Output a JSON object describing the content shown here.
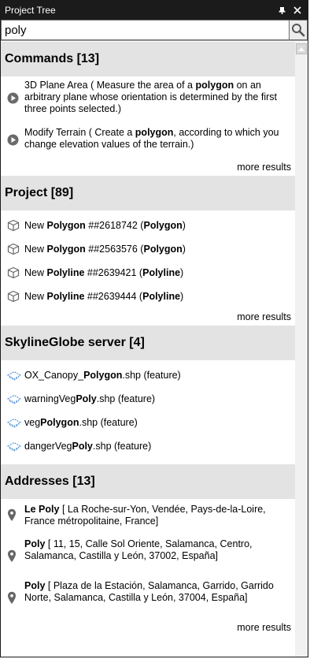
{
  "window": {
    "title": "Project Tree",
    "pin_glyph": "⊓",
    "close_glyph": "✕"
  },
  "search": {
    "value": "poly",
    "button_icon": "search-icon"
  },
  "sections": {
    "commands": {
      "header": "Commands [13]",
      "items": [
        {
          "pre": "3D Plane Area ( Measure the area of a ",
          "bold": "polygon",
          "post": " on an arbitrary plane whose orientation is determined by the first three points selected.)"
        },
        {
          "pre": "Modify Terrain ( Create a ",
          "bold": "polygon",
          "post": ", according to which you change elevation values of the terrain.)"
        }
      ],
      "more": "more results"
    },
    "project": {
      "header": "Project [89]",
      "items": [
        {
          "a": "New ",
          "b": "Polygon",
          "c": " ##2618742 (",
          "d": "Polygon",
          "e": ")"
        },
        {
          "a": "New ",
          "b": "Polygon",
          "c": " ##2563576 (",
          "d": "Polygon",
          "e": ")"
        },
        {
          "a": "New ",
          "b": "Polyline",
          "c": " ##2639421 (",
          "d": "Polyline",
          "e": ")"
        },
        {
          "a": "New ",
          "b": "Polyline",
          "c": " ##2639444 (",
          "d": "Polyline",
          "e": ")"
        }
      ],
      "more": "more results"
    },
    "server": {
      "header": "SkylineGlobe server [4]",
      "items": [
        {
          "a": "OX_Canopy_",
          "b": "Polygon",
          "c": ".shp (feature)"
        },
        {
          "a": "warningVeg",
          "b": "Poly",
          "c": ".shp (feature)"
        },
        {
          "a": "veg",
          "b": "Polygon",
          "c": ".shp (feature)"
        },
        {
          "a": "dangerVeg",
          "b": "Poly",
          "c": ".shp (feature)"
        }
      ]
    },
    "addresses": {
      "header": "Addresses [13]",
      "items": [
        {
          "bold": "Le Poly",
          "rest": " [ La Roche-sur-Yon, Vendée, Pays-de-la-Loire, France métropolitaine, France]"
        },
        {
          "bold": "Poly",
          "rest": " [ 11, 15, Calle Sol Oriente, Salamanca, Centro, Salamanca, Castilla y León, 37002, España]"
        },
        {
          "bold": "Poly",
          "rest": " [ Plaza de la Estación, Salamanca, Garrido, Garrido Norte, Salamanca, Castilla y León, 37004, España]"
        }
      ],
      "more": "more results"
    }
  }
}
